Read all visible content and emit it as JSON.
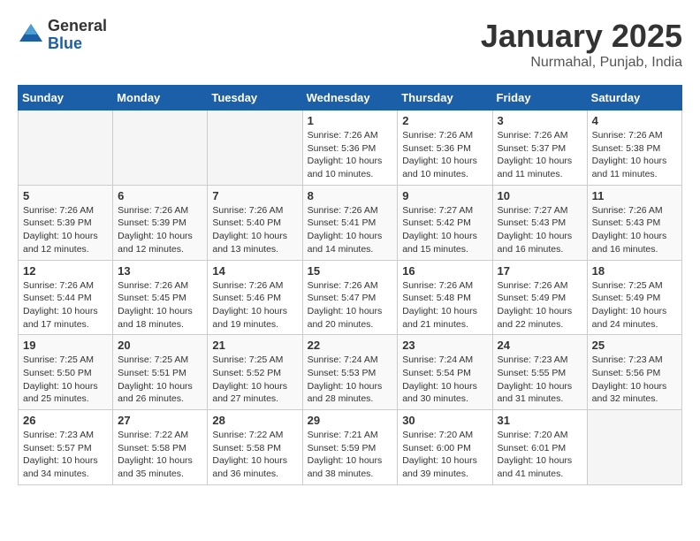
{
  "header": {
    "logo": {
      "general": "General",
      "blue": "Blue"
    },
    "title": "January 2025",
    "subtitle": "Nurmahal, Punjab, India"
  },
  "weekdays": [
    "Sunday",
    "Monday",
    "Tuesday",
    "Wednesday",
    "Thursday",
    "Friday",
    "Saturday"
  ],
  "weeks": [
    [
      {
        "day": "",
        "info": ""
      },
      {
        "day": "",
        "info": ""
      },
      {
        "day": "",
        "info": ""
      },
      {
        "day": "1",
        "info": "Sunrise: 7:26 AM\nSunset: 5:36 PM\nDaylight: 10 hours\nand 10 minutes."
      },
      {
        "day": "2",
        "info": "Sunrise: 7:26 AM\nSunset: 5:36 PM\nDaylight: 10 hours\nand 10 minutes."
      },
      {
        "day": "3",
        "info": "Sunrise: 7:26 AM\nSunset: 5:37 PM\nDaylight: 10 hours\nand 11 minutes."
      },
      {
        "day": "4",
        "info": "Sunrise: 7:26 AM\nSunset: 5:38 PM\nDaylight: 10 hours\nand 11 minutes."
      }
    ],
    [
      {
        "day": "5",
        "info": "Sunrise: 7:26 AM\nSunset: 5:39 PM\nDaylight: 10 hours\nand 12 minutes."
      },
      {
        "day": "6",
        "info": "Sunrise: 7:26 AM\nSunset: 5:39 PM\nDaylight: 10 hours\nand 12 minutes."
      },
      {
        "day": "7",
        "info": "Sunrise: 7:26 AM\nSunset: 5:40 PM\nDaylight: 10 hours\nand 13 minutes."
      },
      {
        "day": "8",
        "info": "Sunrise: 7:26 AM\nSunset: 5:41 PM\nDaylight: 10 hours\nand 14 minutes."
      },
      {
        "day": "9",
        "info": "Sunrise: 7:27 AM\nSunset: 5:42 PM\nDaylight: 10 hours\nand 15 minutes."
      },
      {
        "day": "10",
        "info": "Sunrise: 7:27 AM\nSunset: 5:43 PM\nDaylight: 10 hours\nand 16 minutes."
      },
      {
        "day": "11",
        "info": "Sunrise: 7:26 AM\nSunset: 5:43 PM\nDaylight: 10 hours\nand 16 minutes."
      }
    ],
    [
      {
        "day": "12",
        "info": "Sunrise: 7:26 AM\nSunset: 5:44 PM\nDaylight: 10 hours\nand 17 minutes."
      },
      {
        "day": "13",
        "info": "Sunrise: 7:26 AM\nSunset: 5:45 PM\nDaylight: 10 hours\nand 18 minutes."
      },
      {
        "day": "14",
        "info": "Sunrise: 7:26 AM\nSunset: 5:46 PM\nDaylight: 10 hours\nand 19 minutes."
      },
      {
        "day": "15",
        "info": "Sunrise: 7:26 AM\nSunset: 5:47 PM\nDaylight: 10 hours\nand 20 minutes."
      },
      {
        "day": "16",
        "info": "Sunrise: 7:26 AM\nSunset: 5:48 PM\nDaylight: 10 hours\nand 21 minutes."
      },
      {
        "day": "17",
        "info": "Sunrise: 7:26 AM\nSunset: 5:49 PM\nDaylight: 10 hours\nand 22 minutes."
      },
      {
        "day": "18",
        "info": "Sunrise: 7:25 AM\nSunset: 5:49 PM\nDaylight: 10 hours\nand 24 minutes."
      }
    ],
    [
      {
        "day": "19",
        "info": "Sunrise: 7:25 AM\nSunset: 5:50 PM\nDaylight: 10 hours\nand 25 minutes."
      },
      {
        "day": "20",
        "info": "Sunrise: 7:25 AM\nSunset: 5:51 PM\nDaylight: 10 hours\nand 26 minutes."
      },
      {
        "day": "21",
        "info": "Sunrise: 7:25 AM\nSunset: 5:52 PM\nDaylight: 10 hours\nand 27 minutes."
      },
      {
        "day": "22",
        "info": "Sunrise: 7:24 AM\nSunset: 5:53 PM\nDaylight: 10 hours\nand 28 minutes."
      },
      {
        "day": "23",
        "info": "Sunrise: 7:24 AM\nSunset: 5:54 PM\nDaylight: 10 hours\nand 30 minutes."
      },
      {
        "day": "24",
        "info": "Sunrise: 7:23 AM\nSunset: 5:55 PM\nDaylight: 10 hours\nand 31 minutes."
      },
      {
        "day": "25",
        "info": "Sunrise: 7:23 AM\nSunset: 5:56 PM\nDaylight: 10 hours\nand 32 minutes."
      }
    ],
    [
      {
        "day": "26",
        "info": "Sunrise: 7:23 AM\nSunset: 5:57 PM\nDaylight: 10 hours\nand 34 minutes."
      },
      {
        "day": "27",
        "info": "Sunrise: 7:22 AM\nSunset: 5:58 PM\nDaylight: 10 hours\nand 35 minutes."
      },
      {
        "day": "28",
        "info": "Sunrise: 7:22 AM\nSunset: 5:58 PM\nDaylight: 10 hours\nand 36 minutes."
      },
      {
        "day": "29",
        "info": "Sunrise: 7:21 AM\nSunset: 5:59 PM\nDaylight: 10 hours\nand 38 minutes."
      },
      {
        "day": "30",
        "info": "Sunrise: 7:20 AM\nSunset: 6:00 PM\nDaylight: 10 hours\nand 39 minutes."
      },
      {
        "day": "31",
        "info": "Sunrise: 7:20 AM\nSunset: 6:01 PM\nDaylight: 10 hours\nand 41 minutes."
      },
      {
        "day": "",
        "info": ""
      }
    ]
  ]
}
